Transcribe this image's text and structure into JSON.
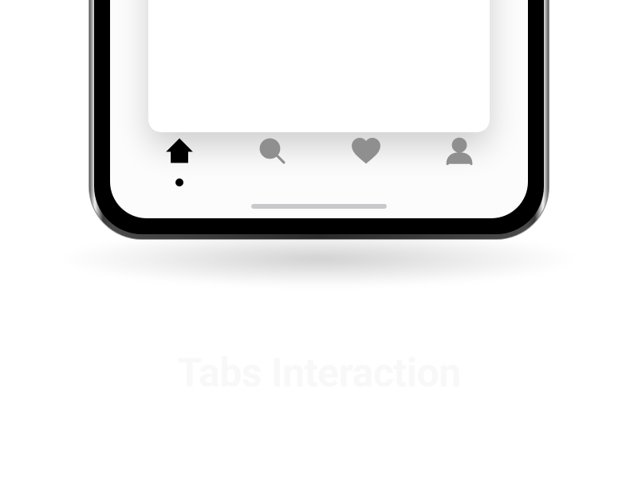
{
  "title": "Tabs Interaction",
  "tabs": {
    "active_index": 0,
    "items": [
      {
        "id": "home",
        "name": "home-icon",
        "active": true
      },
      {
        "id": "search",
        "name": "search-icon",
        "active": false
      },
      {
        "id": "likes",
        "name": "heart-icon",
        "active": false
      },
      {
        "id": "profile",
        "name": "person-icon",
        "active": false
      }
    ]
  },
  "colors": {
    "tab_active": "#000000",
    "tab_inactive": "#8f8f8f",
    "home_indicator": "#c9c9cb",
    "screen_bg": "#fcfcfc"
  }
}
